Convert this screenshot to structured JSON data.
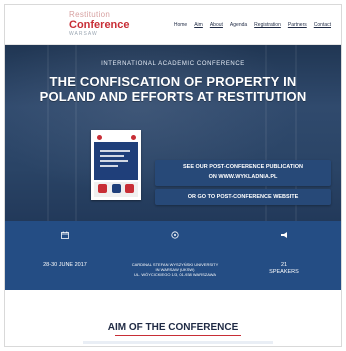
{
  "logo": {
    "line1": "Restitution",
    "line2": "Conference",
    "line3": "WARSAW"
  },
  "nav": {
    "items": [
      "Home",
      "Aim",
      "About",
      "Agenda",
      "Registration",
      "Partners",
      "Contact"
    ]
  },
  "hero": {
    "kicker": "INTERNATIONAL ACADEMIC CONFERENCE",
    "title": "THE CONFISCATION OF PROPERTY IN POLAND AND EFFORTS AT RESTITUTION",
    "publication_line1": "SEE OUR POST-CONFERENCE PUBLICATION",
    "publication_line2": "ON WWW.WYKLADNIA.PL",
    "website_button": "OR GO TO POST-CONFERENCE WEBSITE"
  },
  "info": {
    "date": "28-30 JUNE 2017",
    "venue_line1": "CARDINAL STEFAN WYSZYŃSKI UNIVERSITY",
    "venue_line2": "IN WARSAW (UKSW)",
    "venue_line3": "UL. WÓYCICKIEGO 1/3, 01-938 WARSZAWA",
    "speakers_count": "21",
    "speakers_label": "SPEAKERS"
  },
  "aim": {
    "title": "AIM OF THE CONFERENCE"
  },
  "colors": {
    "hero_bg": "#2a4466",
    "info_bg": "#244d84",
    "accent": "#c82e36"
  }
}
